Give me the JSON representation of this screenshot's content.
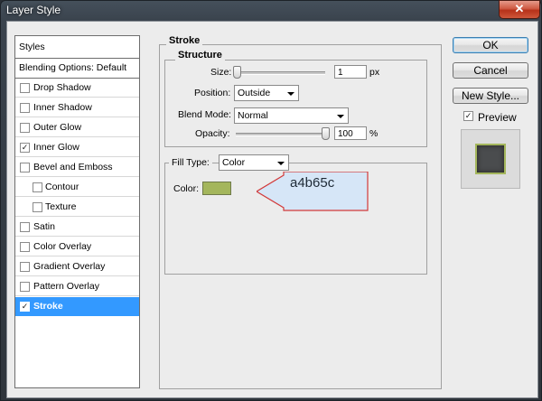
{
  "window": {
    "title": "Layer Style",
    "close_glyph": "✕"
  },
  "sidebar": {
    "items": [
      {
        "label": "Styles",
        "has_checkbox": false
      },
      {
        "label": "Blending Options: Default",
        "has_checkbox": false
      },
      {
        "label": "Drop Shadow",
        "has_checkbox": true,
        "checked": false
      },
      {
        "label": "Inner Shadow",
        "has_checkbox": true,
        "checked": false
      },
      {
        "label": "Outer Glow",
        "has_checkbox": true,
        "checked": false
      },
      {
        "label": "Inner Glow",
        "has_checkbox": true,
        "checked": true
      },
      {
        "label": "Bevel and Emboss",
        "has_checkbox": true,
        "checked": false
      },
      {
        "label": "Contour",
        "has_checkbox": true,
        "checked": false,
        "indent": true
      },
      {
        "label": "Texture",
        "has_checkbox": true,
        "checked": false,
        "indent": true
      },
      {
        "label": "Satin",
        "has_checkbox": true,
        "checked": false
      },
      {
        "label": "Color Overlay",
        "has_checkbox": true,
        "checked": false
      },
      {
        "label": "Gradient Overlay",
        "has_checkbox": true,
        "checked": false
      },
      {
        "label": "Pattern Overlay",
        "has_checkbox": true,
        "checked": false
      },
      {
        "label": "Stroke",
        "has_checkbox": true,
        "checked": true,
        "selected": true
      }
    ]
  },
  "stroke": {
    "section_title": "Stroke",
    "structure_title": "Structure",
    "size_label": "Size:",
    "size_value": "1",
    "size_unit": "px",
    "size_fraction": 0.0,
    "position_label": "Position:",
    "position_value": "Outside",
    "blend_label": "Blend Mode:",
    "blend_value": "Normal",
    "opacity_label": "Opacity:",
    "opacity_value": "100",
    "opacity_unit": "%",
    "opacity_fraction": 1.0,
    "fill_type_label": "Fill Type:",
    "fill_type_value": "Color",
    "color_label": "Color:",
    "color_hex": "#a4b65c",
    "callout_text": "a4b65c"
  },
  "buttons": {
    "ok": "OK",
    "cancel": "Cancel",
    "new_style": "New Style..."
  },
  "preview": {
    "label": "Preview",
    "checked": true
  },
  "colors": {
    "selection": "#3399ff",
    "callout_border": "#d23a3a",
    "callout_fill": "#d6e6f7"
  }
}
